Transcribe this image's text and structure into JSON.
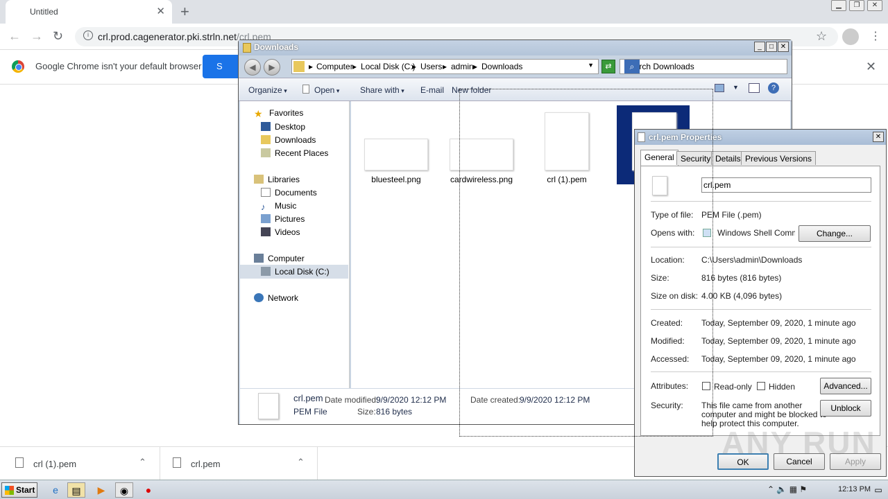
{
  "browser": {
    "tab_title": "Untitled",
    "url_host": "crl.prod.cagenerator.pki.strln.net",
    "url_path": "/crl.pem",
    "info_message": "Google Chrome isn't your default browser",
    "set_default_label": "S"
  },
  "explorer": {
    "title": "Downloads",
    "breadcrumbs": [
      "Computer",
      "Local Disk (C:)",
      "Users",
      "admin",
      "Downloads"
    ],
    "search_placeholder": "Search Downloads",
    "commands": [
      "Organize",
      "Open",
      "Share with",
      "E-mail",
      "New folder"
    ],
    "nav": {
      "favorites": "Favorites",
      "desktop": "Desktop",
      "downloads": "Downloads",
      "recent": "Recent Places",
      "libraries": "Libraries",
      "documents": "Documents",
      "music": "Music",
      "pictures": "Pictures",
      "videos": "Videos",
      "computer": "Computer",
      "localdisk": "Local Disk (C:)",
      "network": "Network"
    },
    "files": [
      "bluesteel.png",
      "cardwireless.png",
      "crl (1).pem",
      "crl.pem"
    ],
    "details": {
      "name": "crl.pem",
      "type": "PEM File",
      "date_modified_label": "Date modified:",
      "date_modified": "9/9/2020 12:12 PM",
      "size_label": "Size:",
      "size": "816 bytes",
      "date_created_label": "Date created:",
      "date_created": "9/9/2020 12:12 PM"
    }
  },
  "properties": {
    "title": "crl.pem Properties",
    "tabs": [
      "General",
      "Security",
      "Details",
      "Previous Versions"
    ],
    "filename": "crl.pem",
    "type_label": "Type of file:",
    "type_value": "PEM File (.pem)",
    "opens_label": "Opens with:",
    "opens_value": "Windows Shell Commor",
    "change_btn": "Change...",
    "location_label": "Location:",
    "location_value": "C:\\Users\\admin\\Downloads",
    "size_label": "Size:",
    "size_value": "816 bytes (816 bytes)",
    "sizeondisk_label": "Size on disk:",
    "sizeondisk_value": "4.00 KB (4,096 bytes)",
    "created_label": "Created:",
    "created_value": "Today, September 09, 2020, 1 minute ago",
    "modified_label": "Modified:",
    "modified_value": "Today, September 09, 2020, 1 minute ago",
    "accessed_label": "Accessed:",
    "accessed_value": "Today, September 09, 2020, 1 minute ago",
    "attributes_label": "Attributes:",
    "readonly_label": "Read-only",
    "hidden_label": "Hidden",
    "advanced_btn": "Advanced...",
    "security_label": "Security:",
    "security_text_1": "This file came from another",
    "security_text_2": "computer and might be blocked to",
    "security_text_3": "help protect this computer.",
    "unblock_btn": "Unblock",
    "ok_btn": "OK",
    "cancel_btn": "Cancel",
    "apply_btn": "Apply"
  },
  "shelf": {
    "items": [
      "crl (1).pem",
      "crl.pem"
    ]
  },
  "watermark": "ANY RUN",
  "taskbar": {
    "start": "Start",
    "time": "12:13 PM"
  }
}
